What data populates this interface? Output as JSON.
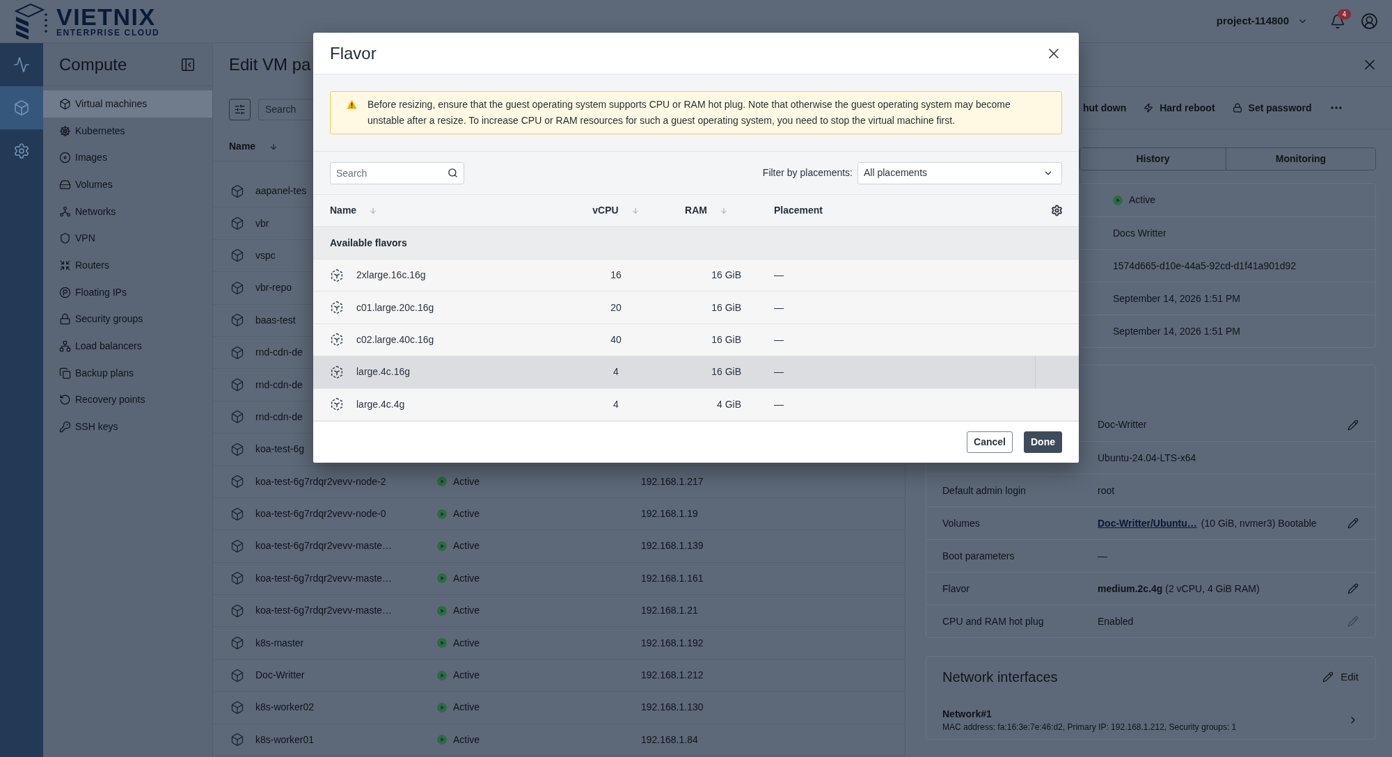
{
  "header": {
    "logo_name": "VIETNIX",
    "logo_tagline": "ENTERPRISE CLOUD",
    "project": "project-114800",
    "notifications": "4"
  },
  "rail": [
    {
      "selected": false
    },
    {
      "selected": true
    },
    {
      "selected": false
    }
  ],
  "sidebar": {
    "title": "Compute",
    "items": [
      {
        "label": "Virtual machines",
        "selected": true
      },
      {
        "label": "Kubernetes",
        "selected": false
      },
      {
        "label": "Images",
        "selected": false
      },
      {
        "label": "Volumes",
        "selected": false
      },
      {
        "label": "Networks",
        "selected": false
      },
      {
        "label": "VPN",
        "selected": false
      },
      {
        "label": "Routers",
        "selected": false
      },
      {
        "label": "Floating IPs",
        "selected": false
      },
      {
        "label": "Security groups",
        "selected": false
      },
      {
        "label": "Load balancers",
        "selected": false
      },
      {
        "label": "Backup plans",
        "selected": false
      },
      {
        "label": "Recovery points",
        "selected": false
      },
      {
        "label": "SSH keys",
        "selected": false
      }
    ]
  },
  "vm_list": {
    "title": "Edit VM pa",
    "search": {
      "placeholder": "Search"
    },
    "columns": [
      {
        "label": "Name",
        "sortable": true
      }
    ],
    "rows": [
      {
        "name": "aapanel-tes"
      },
      {
        "name": "vbr"
      },
      {
        "name": "vspc"
      },
      {
        "name": "vbr-repo"
      },
      {
        "name": "baas-test"
      },
      {
        "name": "rnd-cdn-de"
      },
      {
        "name": "rnd-cdn-de"
      },
      {
        "name": "rnd-cdn-de"
      },
      {
        "name": "koa-test-6g"
      },
      {
        "name": "koa-test-6g7rdqr2vevv-node-2",
        "status": "Active",
        "ip": "192.168.1.217"
      },
      {
        "name": "koa-test-6g7rdqr2vevv-node-0",
        "status": "Active",
        "ip": "192.168.1.19"
      },
      {
        "name": "koa-test-6g7rdqr2vevv-maste…",
        "status": "Active",
        "ip": "192.168.1.139"
      },
      {
        "name": "koa-test-6g7rdqr2vevv-maste…",
        "status": "Active",
        "ip": "192.168.1.161"
      },
      {
        "name": "koa-test-6g7rdqr2vevv-maste…",
        "status": "Active",
        "ip": "192.168.1.21"
      },
      {
        "name": "k8s-master",
        "status": "Active",
        "ip": "192.168.1.192"
      },
      {
        "name": "Doc-Writter",
        "status": "Active",
        "ip": "192.168.1.212"
      },
      {
        "name": "k8s-worker02",
        "status": "Active",
        "ip": "192.168.1.130"
      },
      {
        "name": "k8s-worker01",
        "status": "Active",
        "ip": "192.168.1.84"
      }
    ]
  },
  "vm_panel": {
    "actions": [
      "hut down",
      "Hard reboot",
      "Set password"
    ],
    "tabs": [
      {
        "label": "History",
        "selected": false
      },
      {
        "label": "Monitoring",
        "selected": false
      }
    ],
    "summary": [
      {
        "kind": "status",
        "value": "Active"
      },
      {
        "kind": "text",
        "value": "Docs Writter"
      },
      {
        "kind": "text",
        "value": "1574d665-d10e-44a5-92cd-d1f41a901d92"
      },
      {
        "kind": "text",
        "value": "September 14, 2026 1:51 PM"
      },
      {
        "kind": "text",
        "value": "September 14, 2026 1:51 PM"
      }
    ],
    "properties": [
      {
        "kind": "text",
        "value": "Doc-Writter",
        "edit_button": {
          "disabled": false
        }
      },
      {
        "kind": "text",
        "value": "Ubuntu-24.04-LTS-x64"
      },
      {
        "kind": "text",
        "label": "Default admin login",
        "value": "root"
      },
      {
        "kind": "link",
        "label": "Volumes",
        "link": "Doc-Writter/Ubuntu…",
        "value": "(10 GiB, nvmer3) Bootable",
        "edit_button": {
          "disabled": false
        }
      },
      {
        "kind": "text",
        "label": "Boot parameters",
        "value": "—"
      },
      {
        "kind": "text",
        "label": "Flavor",
        "value": "**medium.2c.4g** (2 vCPU, 4 GiB RAM)",
        "edit_button": {
          "disabled": false
        }
      },
      {
        "kind": "text",
        "label": "CPU and RAM hot plug",
        "value": "Enabled",
        "edit_button": {
          "disabled": true
        }
      }
    ],
    "network_interfaces": {
      "title": "Network interfaces",
      "edit_label": "Edit",
      "items": [
        {
          "name": "Network#1",
          "details": "MAC address: fa:16:3e:7e:46:d2, Primary IP: 192.168.1.212, Security groups: 1"
        }
      ]
    }
  },
  "flavor_dialog": {
    "title": "Flavor",
    "alert": "Before resizing, ensure that the guest operating system supports CPU or RAM hot plug. Note that otherwise the guest operating system may become unstable after a resize. To increase CPU or RAM resources for such a guest operating system, you need to stop the virtual machine first.",
    "search": {
      "placeholder": "Search"
    },
    "filter": {
      "label": "Filter by placements:",
      "value": "All placements"
    },
    "columns": [
      {
        "label": "Name",
        "sortable": true
      },
      {
        "label": "vCPU",
        "sortable": true
      },
      {
        "label": "RAM",
        "sortable": true
      },
      {
        "label": "Placement",
        "sortable": false
      }
    ],
    "group": "Available flavors",
    "rows": [
      {
        "name": "2xlarge.16c.16g",
        "vcpu": "16",
        "ram": "16 GiB",
        "placement": "—",
        "selected": false
      },
      {
        "name": "c01.large.20c.16g",
        "vcpu": "20",
        "ram": "16 GiB",
        "placement": "—",
        "selected": false
      },
      {
        "name": "c02.large.40c.16g",
        "vcpu": "40",
        "ram": "16 GiB",
        "placement": "—",
        "selected": false
      },
      {
        "name": "large.4c.16g",
        "vcpu": "4",
        "ram": "16 GiB",
        "placement": "—",
        "selected": true
      },
      {
        "name": "large.4c.4g",
        "vcpu": "4",
        "ram": "4 GiB",
        "placement": "—",
        "selected": false
      }
    ],
    "buttons": [
      {
        "label": "Cancel",
        "kind": "secondary"
      },
      {
        "label": "Done",
        "kind": "primary"
      }
    ]
  }
}
